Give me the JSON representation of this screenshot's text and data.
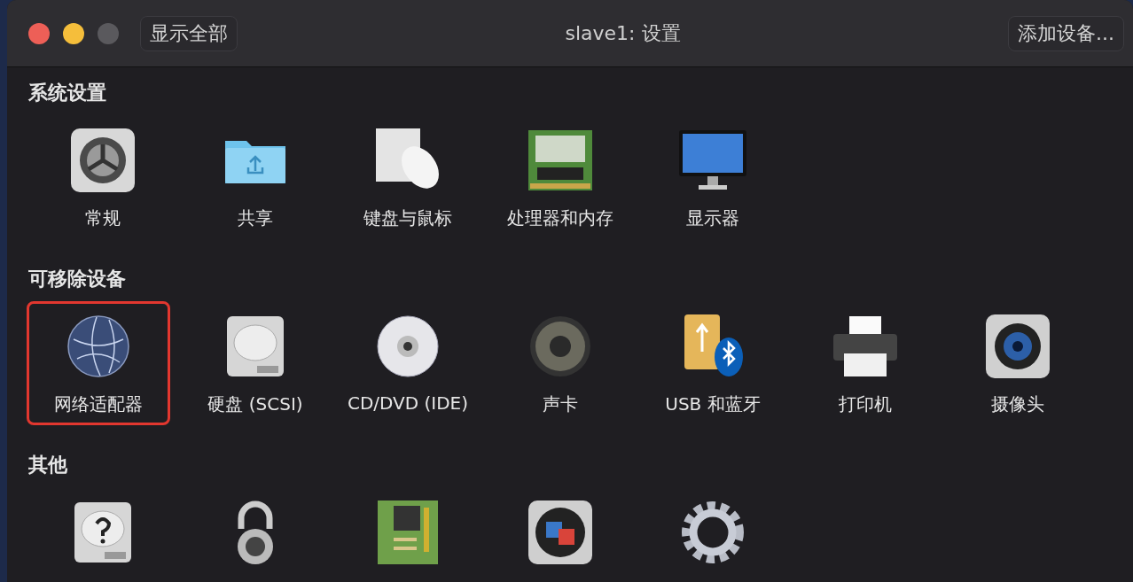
{
  "window": {
    "title": "slave1: 设置",
    "show_all_button": "显示全部",
    "add_device_button": "添加设备..."
  },
  "sections": [
    {
      "title": "系统设置",
      "items": [
        {
          "kind": "gear",
          "label": "常规",
          "selected": false
        },
        {
          "kind": "folder",
          "label": "共享",
          "selected": false
        },
        {
          "kind": "keyboard",
          "label": "键盘与鼠标",
          "selected": false
        },
        {
          "kind": "memory",
          "label": "处理器和内存",
          "selected": false
        },
        {
          "kind": "display",
          "label": "显示器",
          "selected": false
        }
      ]
    },
    {
      "title": "可移除设备",
      "items": [
        {
          "kind": "globe",
          "label": "网络适配器",
          "selected": true
        },
        {
          "kind": "disk",
          "label": "硬盘 (SCSI)",
          "selected": false
        },
        {
          "kind": "cd",
          "label": "CD/DVD (IDE)",
          "selected": false
        },
        {
          "kind": "speaker",
          "label": "声卡",
          "selected": false
        },
        {
          "kind": "usb",
          "label": "USB 和蓝牙",
          "selected": false
        },
        {
          "kind": "printer",
          "label": "打印机",
          "selected": false
        },
        {
          "kind": "camera",
          "label": "摄像头",
          "selected": false
        }
      ]
    },
    {
      "title": "其他",
      "items": [
        {
          "kind": "unknown-disk",
          "selected": false
        },
        {
          "kind": "lock",
          "selected": false
        },
        {
          "kind": "board",
          "selected": false
        },
        {
          "kind": "app",
          "selected": false
        },
        {
          "kind": "cog",
          "selected": false
        }
      ]
    }
  ]
}
